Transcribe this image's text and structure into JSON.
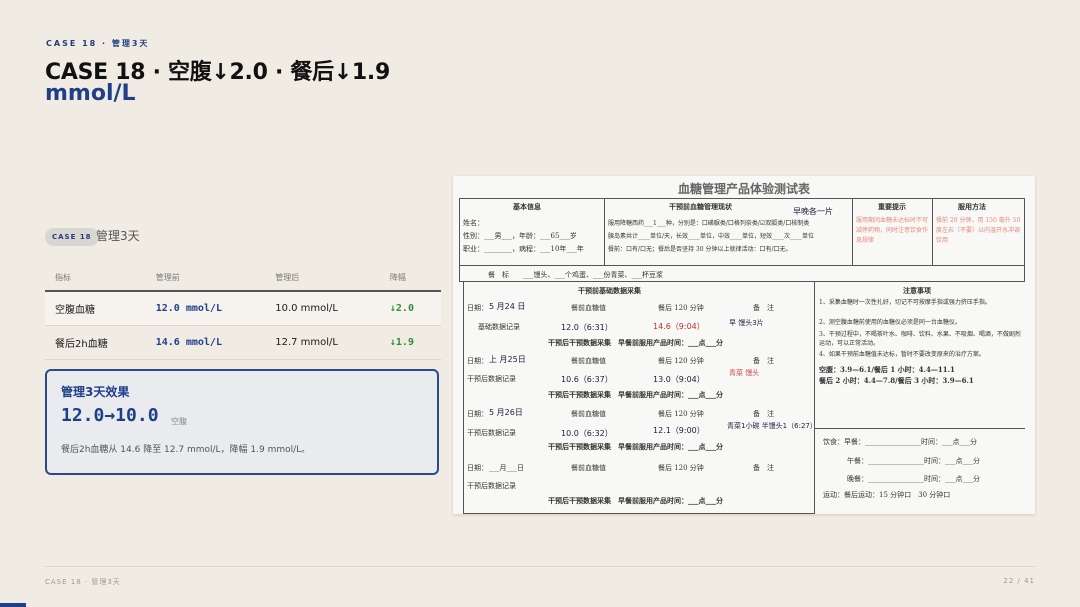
{
  "header": {
    "kicker": "CASE 18 · 管理3天",
    "title_line1": "CASE 18 · 空腹↓2.0 · 餐后↓1.9",
    "title_line2": "mmol/L"
  },
  "case": {
    "tag": "CASE 18",
    "subtitle": "管理3天"
  },
  "table": {
    "headers": [
      "指标",
      "管理前",
      "管理后",
      "降幅"
    ],
    "rows": [
      {
        "metric": "空腹血糖",
        "before": "12.0 mmol/L",
        "after": "10.0 mmol/L",
        "drop": "↓2.0"
      },
      {
        "metric": "餐后2h血糖",
        "before": "14.6 mmol/L",
        "after": "12.7 mmol/L",
        "drop": "↓1.9"
      }
    ]
  },
  "effect": {
    "title": "管理3天效果",
    "value": "12.0→10.0",
    "label": "空腹",
    "note": "餐后2h血糖从 14.6 降至 12.7 mmol/L，降幅 1.9 mmol/L。"
  },
  "form": {
    "title": "血糖管理产品体验测试表",
    "h_basic": "基本信息",
    "h_status": "干预前血糖管理现状",
    "h_tip": "重要提示",
    "h_method": "服用方法",
    "basic_line1": "姓名：",
    "basic_line2": "性别：___男___，年龄：___65___岁",
    "basic_line3": "职业：________，病程：___10年___年",
    "status_line1": "服用降糖西药___1___种，分别是：口磺脲类/口格列奈类/☑双胍类/口核制类",
    "status_line2": "胰岛素共计____单位/天，长效____单位，中效____单位，短效____次____单位",
    "status_line3": "餐前：口有/口无；餐后是否坚持 30 分钟以上就律活动：口有/口无。",
    "status_hand": "早晚各一片",
    "tip_text": "服用期间血糖未达标时不可减停药物，同时注意饮食作息规律",
    "method_text": "餐前 20 分钟，用 150 毫升 50 度左右（不要）以内温开水冲调饮用",
    "meal_row": "餐　标　　___馒头、___个鸡蛋、___份青菜、___杯豆浆",
    "pre_header": "干预前基础数据采集",
    "notes_header": "注意事项",
    "col_date": "日期：",
    "col_fasting": "餐前血糖值",
    "col_post": "餐后 120 分钟",
    "col_remark": "备　注",
    "row_basic": "基础数据记录",
    "row_after": "干预后数据记录",
    "collect_line": "干预后干预数据采集　早餐前服用产品时间：___点___分",
    "day1_date": "5 月24 日",
    "day1_fasting": "12.0（6:31）",
    "day1_post": "14.6（9:04）",
    "day1_remark": "早 馒头3片",
    "day2_date": "上 月25日",
    "day2_fasting": "10.6（6:37）",
    "day2_post": "13.0（9:04）",
    "day2_remark": "青菜 馒头",
    "day3_date": "5 月26日",
    "day3_fasting": "10.0（6:32）",
    "day3_post": "12.1（9:00）",
    "day3_remark": "青菜1小碗 半馒头1（6:27）",
    "day4_date": "___月___日",
    "note1": "1、采集血糖时一次性扎好，切记不可按摩手指或强力挤压手指。",
    "note2": "2、测空腹血糖前使用的血糖仪必须是同一台血糖仪。",
    "note3": "3、干预过程中，不喝茶叶水、咖啡、饮料、水果、不吸烟、喝酒，不做剧烈运动，可以正常活动。",
    "note4": "4、如果干预前血糖值未达标，暂时不要改变原来的治疗方案。",
    "ref1": "空腹：3.9—6.1/餐后 1 小时：4.4—11.1",
    "ref2": "餐后 2 小时：4.4—7.8/餐后 3 小时：3.9—6.1",
    "diet1": "饮食：早餐：________________时间：___点___分",
    "diet2": "午餐：________________时间：___点___分",
    "diet3": "晚餐：________________时间：___点___分",
    "exercise": "运动：餐后运动：15 分钟口　30 分钟口"
  },
  "footer": {
    "left": "CASE 18 · 管理3天",
    "right": "22 / 41"
  },
  "progress": 0.024,
  "colors": {
    "accent": "#1f3f8a",
    "drop_green": "#2e8b3a",
    "background": "#f1ece3"
  }
}
